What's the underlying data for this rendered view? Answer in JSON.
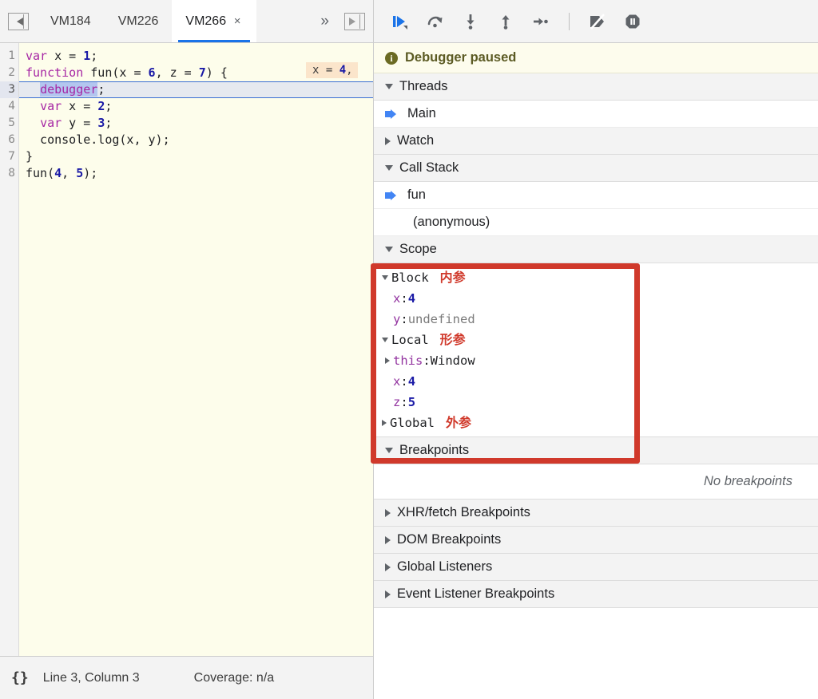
{
  "editor": {
    "nav_prev_icon": "nav-prev-icon",
    "nav_next_icon": "nav-next-icon",
    "overflow_label": "»",
    "tabs": [
      {
        "label": "VM184",
        "active": false,
        "closable": false
      },
      {
        "label": "VM226",
        "active": false,
        "closable": false
      },
      {
        "label": "VM266",
        "active": true,
        "closable": true,
        "close_label": "×"
      }
    ],
    "line_numbers": [
      "1",
      "2",
      "3",
      "4",
      "5",
      "6",
      "7",
      "8"
    ],
    "code_lines": [
      {
        "n": 1,
        "tokens": [
          {
            "t": "var",
            "c": "kw"
          },
          {
            "t": " x = ",
            "c": "plain"
          },
          {
            "t": "1",
            "c": "num"
          },
          {
            "t": ";",
            "c": "plain"
          }
        ]
      },
      {
        "n": 2,
        "tokens": [
          {
            "t": "function",
            "c": "kw"
          },
          {
            "t": " fun(x = ",
            "c": "plain"
          },
          {
            "t": "6",
            "c": "num"
          },
          {
            "t": ", z = ",
            "c": "plain"
          },
          {
            "t": "7",
            "c": "num"
          },
          {
            "t": ") {",
            "c": "plain"
          }
        ]
      },
      {
        "n": 3,
        "tokens": [
          {
            "t": "  ",
            "c": "plain"
          },
          {
            "t": "debugger",
            "c": "kw sel"
          },
          {
            "t": ";",
            "c": "plain"
          }
        ]
      },
      {
        "n": 4,
        "tokens": [
          {
            "t": "  ",
            "c": "plain"
          },
          {
            "t": "var",
            "c": "kw"
          },
          {
            "t": " x = ",
            "c": "plain"
          },
          {
            "t": "2",
            "c": "num"
          },
          {
            "t": ";",
            "c": "plain"
          }
        ]
      },
      {
        "n": 5,
        "tokens": [
          {
            "t": "  ",
            "c": "plain"
          },
          {
            "t": "var",
            "c": "kw"
          },
          {
            "t": " y = ",
            "c": "plain"
          },
          {
            "t": "3",
            "c": "num"
          },
          {
            "t": ";",
            "c": "plain"
          }
        ]
      },
      {
        "n": 6,
        "tokens": [
          {
            "t": "  console.log(x, y);",
            "c": "plain"
          }
        ]
      },
      {
        "n": 7,
        "tokens": [
          {
            "t": "}",
            "c": "plain"
          }
        ]
      },
      {
        "n": 8,
        "tokens": [
          {
            "t": "fun(",
            "c": "plain"
          },
          {
            "t": "4",
            "c": "num"
          },
          {
            "t": ", ",
            "c": "plain"
          },
          {
            "t": "5",
            "c": "num"
          },
          {
            "t": ");",
            "c": "plain"
          }
        ]
      }
    ],
    "execution_line": 3,
    "inline_hint": {
      "prefix": "x = ",
      "value": "4",
      "suffix": ","
    },
    "status": {
      "format_icon": "{}",
      "cursor_position": "Line 3, Column 3",
      "coverage": "Coverage: n/a"
    }
  },
  "debugger": {
    "toolbar": [
      {
        "name": "resume-script-execution",
        "icon": "resume-icon"
      },
      {
        "name": "step-over-next-function-call",
        "icon": "step-over-icon"
      },
      {
        "name": "step-into-next-function-call",
        "icon": "step-into-icon"
      },
      {
        "name": "step-out-of-current-function",
        "icon": "step-out-icon"
      },
      {
        "name": "step",
        "icon": "step-icon"
      },
      {
        "name": "deactivate-breakpoints",
        "icon": "deactivate-breakpoints-icon"
      },
      {
        "name": "pause-on-exceptions",
        "icon": "pause-on-exceptions-icon"
      }
    ],
    "paused_banner": {
      "icon": "info-icon",
      "text": "Debugger paused"
    },
    "sections": {
      "threads": {
        "label": "Threads",
        "expanded": true,
        "items": [
          {
            "label": "Main",
            "active": true
          }
        ]
      },
      "watch": {
        "label": "Watch",
        "expanded": false
      },
      "call_stack": {
        "label": "Call Stack",
        "expanded": true,
        "frames": [
          {
            "label": "fun",
            "active": true
          },
          {
            "label": "(anonymous)",
            "active": false
          }
        ]
      },
      "scope": {
        "label": "Scope",
        "expanded": true
      },
      "breakpoints": {
        "label": "Breakpoints",
        "expanded": true,
        "empty_text": "No breakpoints"
      },
      "xhr_fetch_breakpoints": {
        "label": "XHR/fetch Breakpoints",
        "expanded": false
      },
      "dom_breakpoints": {
        "label": "DOM Breakpoints",
        "expanded": false
      },
      "global_listeners": {
        "label": "Global Listeners",
        "expanded": false
      },
      "event_listener_breakpoints": {
        "label": "Event Listener Breakpoints",
        "expanded": false
      }
    },
    "scope_entries": [
      {
        "kind": "scope",
        "label": "Block",
        "expanded": true,
        "annotation": "内参",
        "indent": 1
      },
      {
        "kind": "var",
        "name": "x",
        "value": "4",
        "value_type": "number",
        "indent": 2
      },
      {
        "kind": "var",
        "name": "y",
        "value": "undefined",
        "value_type": "undefined",
        "indent": 2
      },
      {
        "kind": "scope",
        "label": "Local",
        "expanded": true,
        "annotation": "形参",
        "indent": 1
      },
      {
        "kind": "var",
        "name": "this",
        "value": "Window",
        "value_type": "object",
        "expandable": true,
        "indent": 2
      },
      {
        "kind": "var",
        "name": "x",
        "value": "4",
        "value_type": "number",
        "indent": 2
      },
      {
        "kind": "var",
        "name": "z",
        "value": "5",
        "value_type": "number",
        "indent": 2
      },
      {
        "kind": "scope",
        "label": "Global",
        "expanded": false,
        "annotation": "外参",
        "indent": 1
      }
    ]
  },
  "annotation": {
    "red_box_color": "#d0392b",
    "note_color": "#d0392b"
  }
}
